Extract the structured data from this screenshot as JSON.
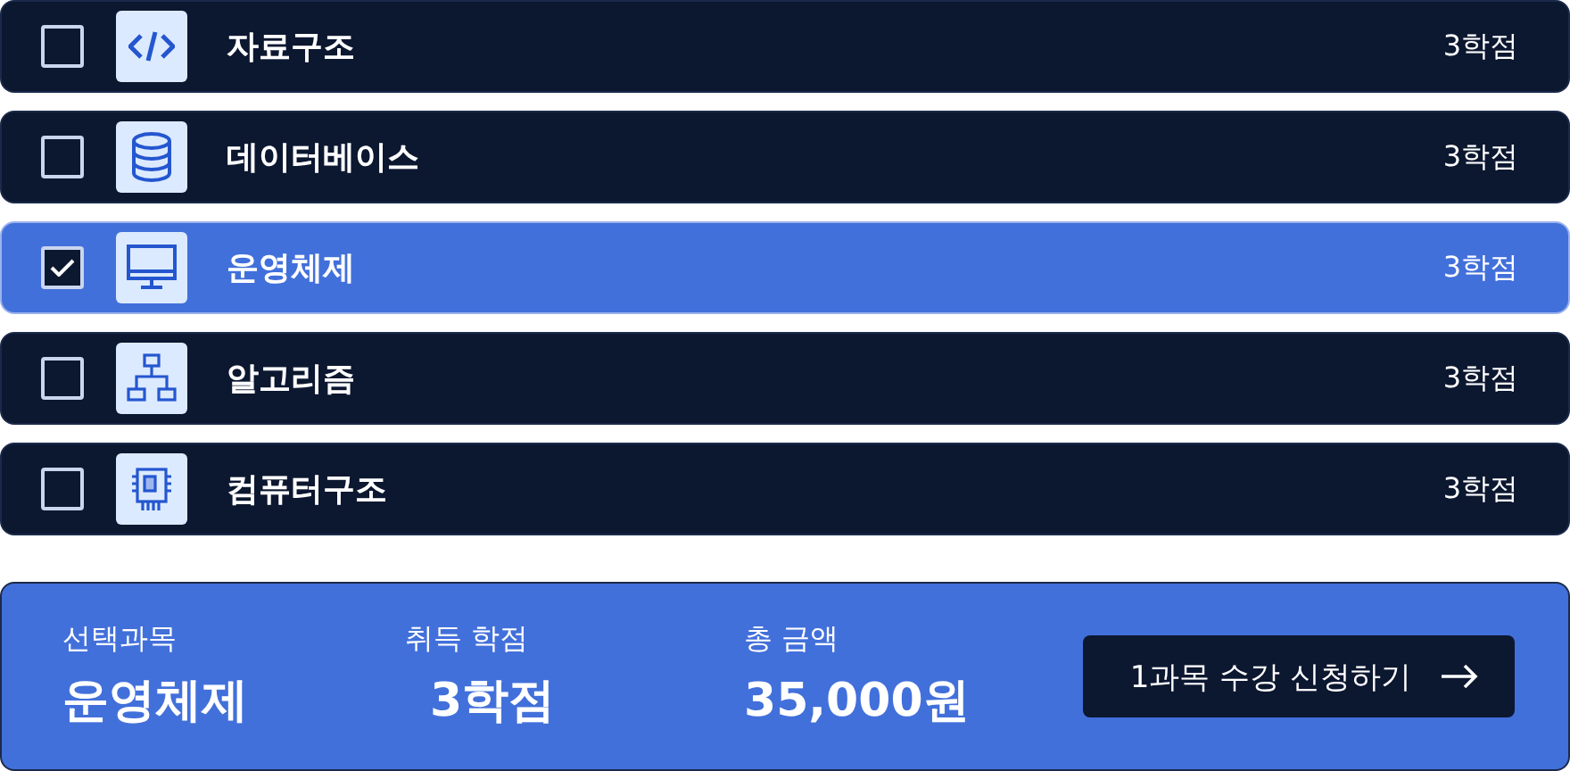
{
  "courses": [
    {
      "name": "자료구조",
      "credits": "3학점",
      "checked": false
    },
    {
      "name": "데이터베이스",
      "credits": "3학점",
      "checked": false
    },
    {
      "name": "운영체제",
      "credits": "3학점",
      "checked": true
    },
    {
      "name": "알고리즘",
      "credits": "3학점",
      "checked": false
    },
    {
      "name": "컴퓨터구조",
      "credits": "3학점",
      "checked": false
    }
  ],
  "summary": {
    "stats": [
      {
        "label": "선택과목",
        "value": "운영체제"
      },
      {
        "label": "취득 학점",
        "value": "3학점"
      },
      {
        "label": "총 금액",
        "value": "35,000원"
      }
    ],
    "button": "1과목 수강 신청하기"
  }
}
